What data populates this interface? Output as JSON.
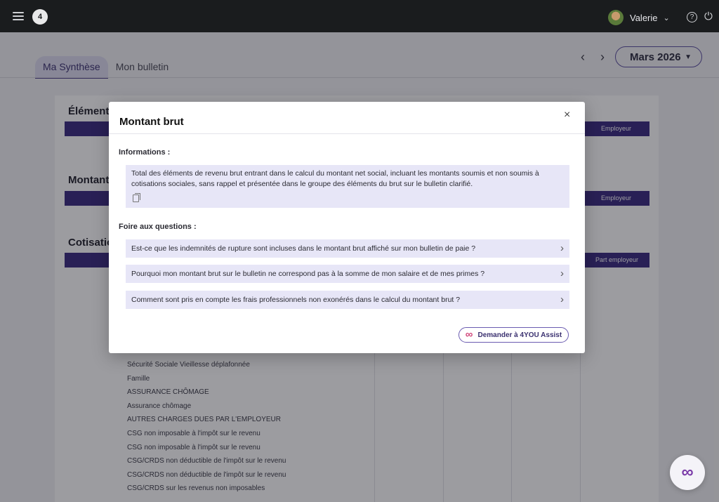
{
  "header": {
    "logo_text": "4",
    "user_name": "Valerie",
    "help_glyph": "?",
    "power_glyph": "⏻"
  },
  "tabs": [
    {
      "label": "Ma Synthèse",
      "active": true
    },
    {
      "label": "Mon bulletin",
      "active": false
    }
  ],
  "period": {
    "prev": "‹",
    "next": "›",
    "month": "Mars 2026"
  },
  "background": {
    "section_elements": "Éléments",
    "section_montant": "Montant",
    "section_cotisations": "Cotisatio",
    "col_employeur_1": "Employeur",
    "col_employeur_2": "Employeur",
    "col_part_employeur": "Part employeur",
    "rows": [
      "Sécurité Sociale Vieillesse déplafonnée",
      "Famille",
      "ASSURANCE CHÔMAGE",
      "Assurance chômage",
      "AUTRES CHARGES DUES PAR L'EMPLOYEUR",
      "CSG non imposable à l'impôt sur le revenu",
      "CSG non imposable à l'impôt sur le revenu",
      "CSG/CRDS non déductible de l'impôt sur le revenu",
      "CSG/CRDS non déductible de l'impôt sur le revenu",
      "CSG/CRDS sur les revenus non imposables"
    ]
  },
  "modal": {
    "title": "Montant brut",
    "close_glyph": "×",
    "info_label": "Informations :",
    "info_text": "Total des éléments de revenu brut entrant dans le calcul du montant net social, incluant les montants soumis et non soumis à cotisations sociales, sans rappel et présentée dans le groupe des éléments du brut sur le bulletin clarifié.",
    "faq_label": "Foire aux questions :",
    "faq": [
      "Est-ce que les indemnités de rupture sont incluses dans le montant brut affiché sur mon bulletin de paie ?",
      "Pourquoi mon montant brut sur le bulletin ne correspond pas à la somme de mon salaire et de mes primes ?",
      "Comment sont pris en compte les frais professionnels non exonérés dans le calcul du montant brut ?"
    ],
    "assist_label": "Demander à 4YOU Assist",
    "chevron": "›"
  },
  "fab": {
    "glyph": "∞"
  },
  "icons": [
    "menu-icon",
    "avatar",
    "chevron-down-icon",
    "help-icon",
    "power-icon",
    "close-icon",
    "copy-icon",
    "chevron-right-icon",
    "infinity-icon"
  ]
}
